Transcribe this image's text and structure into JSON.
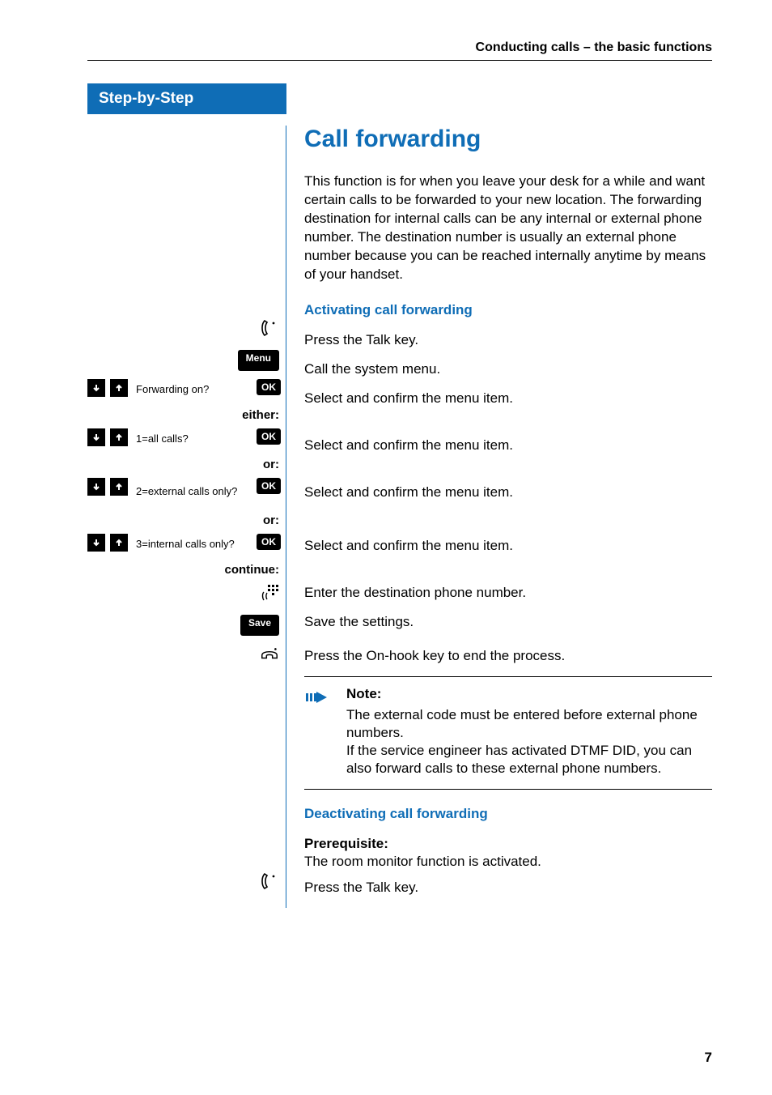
{
  "header": {
    "running_title": "Conducting calls – the basic functions"
  },
  "sidebar": {
    "title": "Step-by-Step",
    "buttons": {
      "menu": "Menu",
      "ok": "OK",
      "save": "Save"
    },
    "rows": {
      "forwarding_on": "Forwarding on?",
      "all_calls": "1=all calls?",
      "external_only": "2=external calls only?",
      "internal_only": "3=internal calls only?"
    },
    "conds": {
      "either": "either:",
      "or1": "or:",
      "or2": "or:",
      "continue": "continue:"
    },
    "icons": {
      "talk": "talk-key-icon",
      "arrow_down": "arrow-down-icon",
      "arrow_up": "arrow-up-icon",
      "keypad": "keypad-icon",
      "onhook": "on-hook-icon"
    }
  },
  "main": {
    "h1": "Call forwarding",
    "intro": "This function is for when you leave your desk for a while and want certain calls to be forwarded to your new location. The forwarding destination for internal calls can be any internal or external phone number. The destination number is usually an external phone number because you can be reached internally anytime by means of your handset.",
    "activating_heading": "Activating call forwarding",
    "steps": {
      "press_talk": "Press the Talk key.",
      "call_menu": "Call the system menu.",
      "select_confirm": "Select and confirm the menu item.",
      "enter_dest": "Enter the destination phone number.",
      "save": "Save the settings.",
      "onhook": "Press the On-hook key to end the process."
    },
    "note": {
      "label": "Note:",
      "text1": "The external code must be entered before external phone numbers.",
      "text2": "If the service engineer has activated DTMF DID, you can also forward calls to these external phone numbers."
    },
    "deactivating_heading": "Deactivating call forwarding",
    "prereq_label": "Prerequisite:",
    "prereq_text": "The room monitor function is activated.",
    "press_talk2": "Press the Talk key."
  },
  "page_number": "7"
}
